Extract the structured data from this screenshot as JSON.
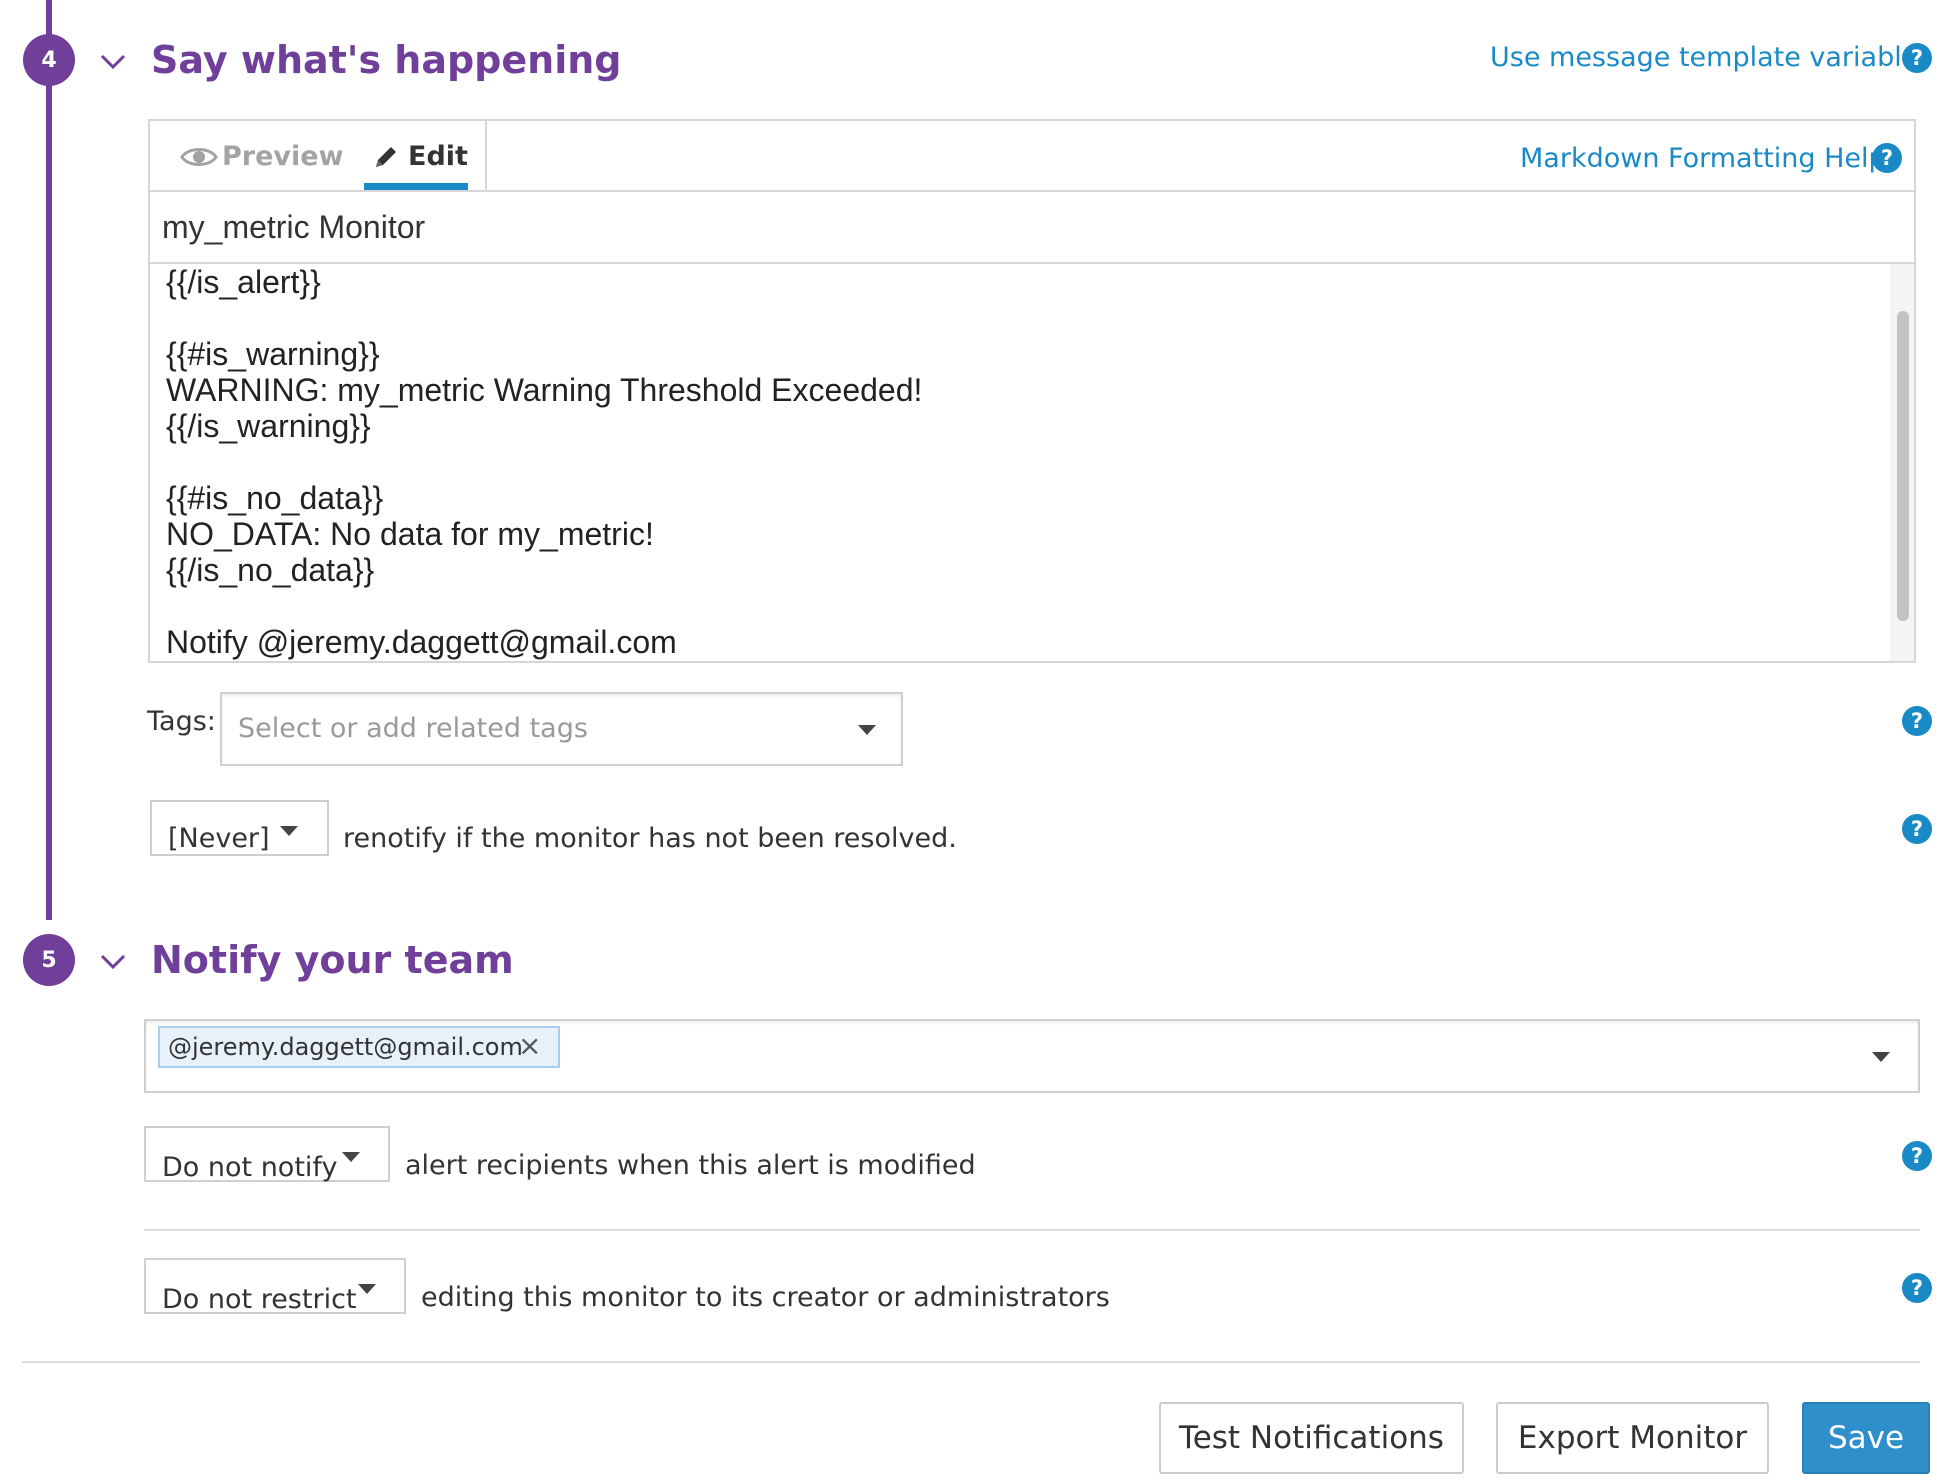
{
  "steps": {
    "say": {
      "number": "4",
      "title": "Say what's happening",
      "template_link": "Use message template variables"
    },
    "notify": {
      "number": "5",
      "title": "Notify your team"
    }
  },
  "editor": {
    "tab_preview": "Preview",
    "tab_edit": "Edit",
    "markdown_help": "Markdown Formatting Help",
    "title_value": "my_metric Monitor",
    "body_value": "{{#is_alert}}\n{{/is_alert}}\n\n{{#is_warning}}\nWARNING: my_metric Warning Threshold Exceeded!\n{{/is_warning}}\n\n{{#is_no_data}}\nNO_DATA: No data for my_metric!\n{{/is_no_data}}\n\nNotify @jeremy.daggett@gmail.com"
  },
  "tags": {
    "label": "Tags:",
    "placeholder": "Select or add related tags"
  },
  "renotify": {
    "value": "[Never]",
    "text": "renotify if the monitor has not been resolved."
  },
  "recipients": {
    "chip": "@jeremy.daggett@gmail.com",
    "chip_remove": "×"
  },
  "modify_notify": {
    "value": "Do not notify",
    "text": "alert recipients when this alert is modified"
  },
  "restrict": {
    "value": "Do not restrict",
    "text": "editing this monitor to its creator or administrators"
  },
  "help_glyph": "?",
  "buttons": {
    "test": "Test Notifications",
    "export": "Export Monitor",
    "save": "Save"
  },
  "colors": {
    "accent_purple": "#6f3f9a",
    "link_blue": "#1a8ac6",
    "save_blue": "#2f8fca"
  }
}
